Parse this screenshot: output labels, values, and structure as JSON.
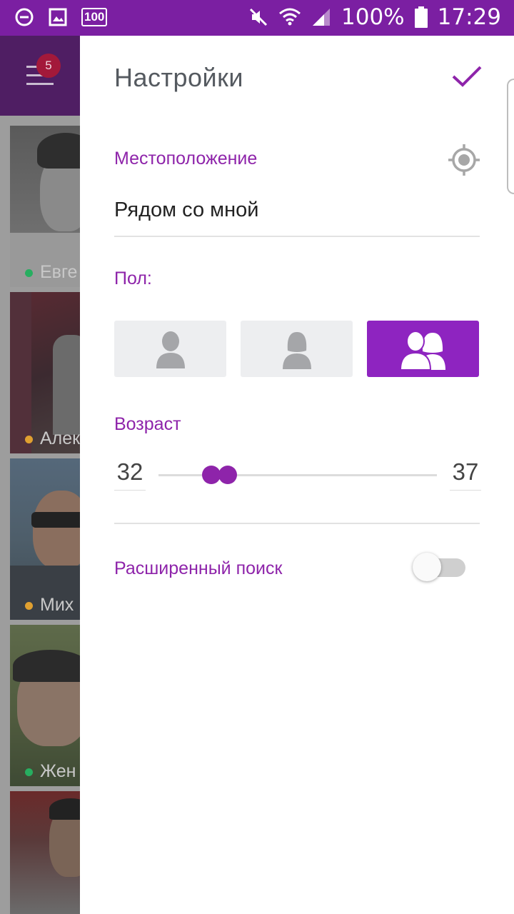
{
  "status_bar": {
    "battery": "100%",
    "time": "17:29",
    "badge_100": "100",
    "icons": [
      "do-not-disturb-icon",
      "image-icon",
      "battery-100-icon",
      "mute-icon",
      "wifi-icon",
      "signal-icon",
      "battery-icon"
    ]
  },
  "background_app": {
    "menu_badge": "5",
    "cards": [
      {
        "name": "Евге",
        "status_color": "#27ae60"
      },
      {
        "name": "Алек",
        "status_color": "#e0a030"
      },
      {
        "name": "Мих",
        "status_color": "#e0a030"
      },
      {
        "name": "Жен",
        "status_color": "#27ae60"
      },
      {
        "name": "",
        "status_color": ""
      }
    ]
  },
  "settings": {
    "title": "Настройки",
    "location": {
      "label": "Местоположение",
      "value": "Рядом со мной"
    },
    "sex": {
      "label": "Пол:",
      "options": [
        "male-icon",
        "female-icon",
        "both-icon"
      ],
      "selected_index": 2
    },
    "age": {
      "label": "Возраст",
      "min": "32",
      "max": "37"
    },
    "advanced": {
      "label": "Расширенный поиск",
      "enabled": false
    }
  },
  "colors": {
    "accent": "#8e24aa",
    "status_bar": "#7b1fa2",
    "selected_button": "#8e24c0"
  }
}
